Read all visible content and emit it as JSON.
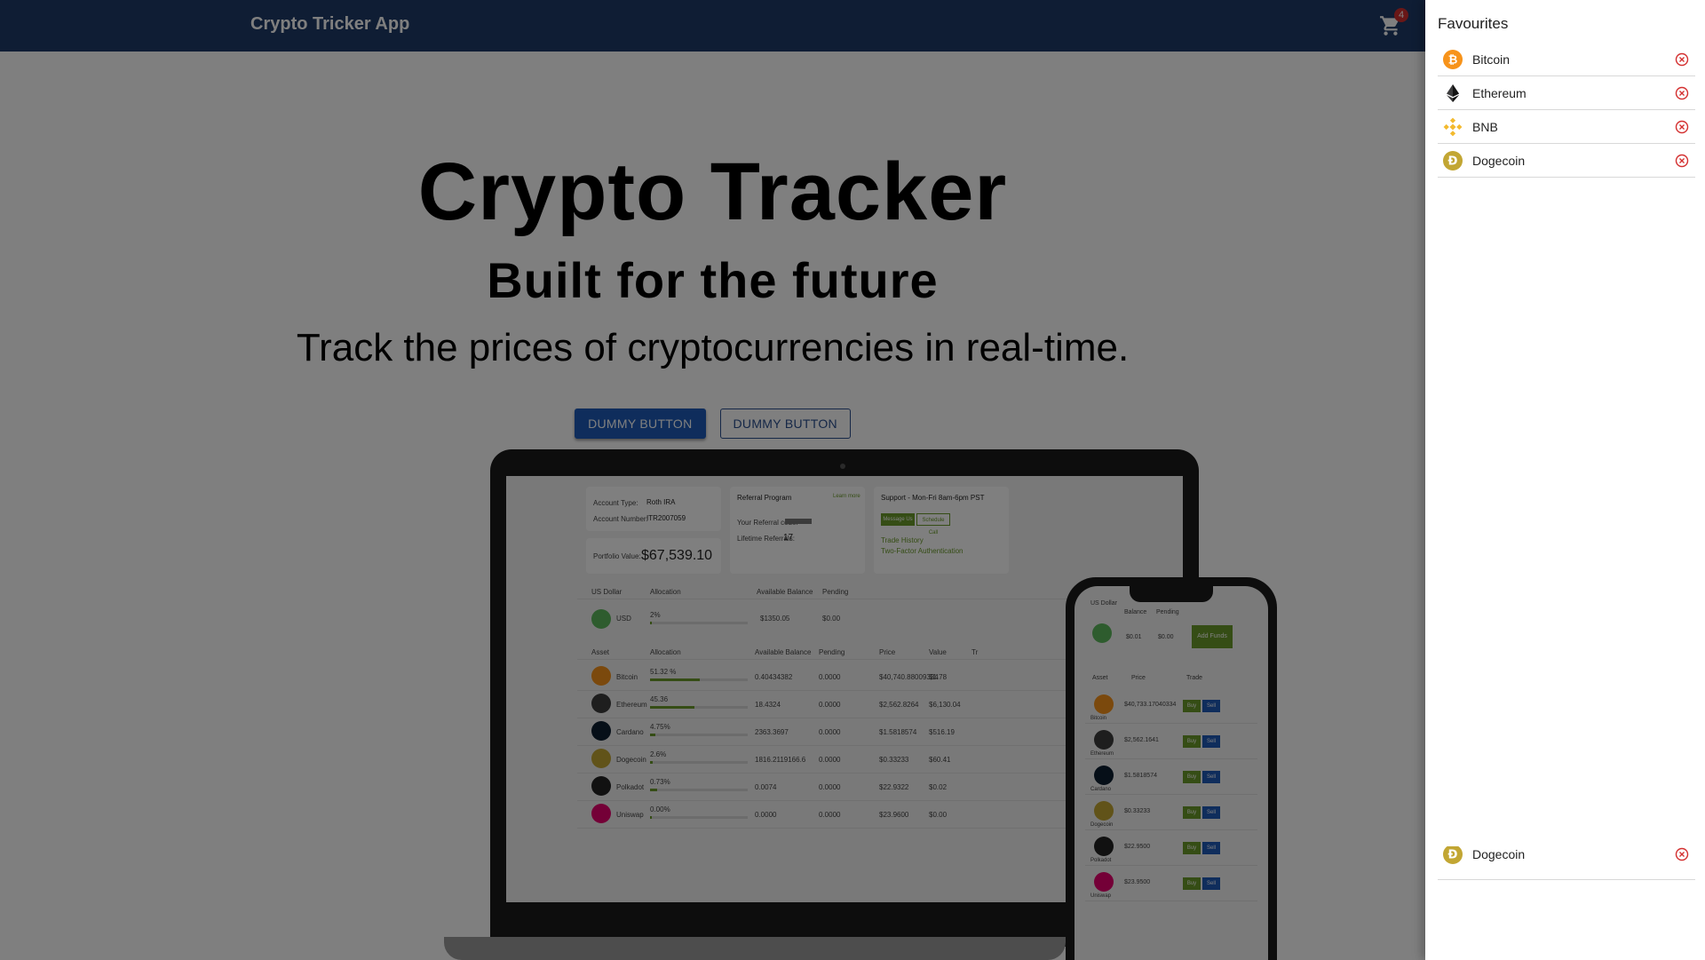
{
  "app": {
    "brand": "Crypto Tricker App",
    "cart_count": "4"
  },
  "hero": {
    "title": "Crypto Tracker",
    "subtitle": "Built for the future",
    "tagline": "Track the prices of cryptocurrencies in real-time.",
    "primary_button": "DUMMY BUTTON",
    "secondary_button": "DUMMY BUTTON"
  },
  "mockup": {
    "account_type_label": "Account Type:",
    "account_type": "Roth IRA",
    "account_number_label": "Account Number:",
    "account_number": "ITR2007059",
    "portfolio_label": "Portfolio Value:",
    "portfolio_value": "$67,539.10",
    "referral_title": "Referral Program",
    "referral_learn": "Learn more",
    "referral_code_label": "Your Referral code:",
    "referral_lifetime_label": "Lifetime Referrals:",
    "referral_lifetime": "17",
    "support_title": "Support - Mon-Fri 8am-6pm PST",
    "support_msg": "Message Us",
    "support_call": "Schedule Call",
    "support_trade_history": "Trade History",
    "support_2fa": "Two-Factor Authentication",
    "usd_header": [
      "US Dollar",
      "Allocation",
      "Available Balance",
      "Pending"
    ],
    "usd_row": {
      "name": "USD",
      "alloc": "2%",
      "balance": "$1350.05",
      "pending": "$0.00"
    },
    "asset_header": [
      "Asset",
      "Allocation",
      "Available Balance",
      "Pending",
      "Price",
      "Value",
      "Tr"
    ],
    "assets": [
      {
        "name": "Bitcoin",
        "alloc": "51.32 %",
        "balance": "0.40434382",
        "pending": "0.0000",
        "price": "$40,740.88009334",
        "value": "$1.78",
        "pct": 0.51,
        "color": "#f7931a"
      },
      {
        "name": "Ethereum",
        "alloc": "45.36",
        "balance": "18.4324",
        "pending": "0.0000",
        "price": "$2,562.8264",
        "value": "$6,130.04",
        "pct": 0.45,
        "color": "#3c3c3d"
      },
      {
        "name": "Cardano",
        "alloc": "4.75%",
        "balance": "2363.3697",
        "pending": "0.0000",
        "price": "$1.5818574",
        "value": "$516.19",
        "pct": 0.05,
        "color": "#0d1e30"
      },
      {
        "name": "Dogecoin",
        "alloc": "2.6%",
        "balance": "1816.2119166.6",
        "pending": "0.0000",
        "price": "$0.33233",
        "value": "$60.41",
        "pct": 0.03,
        "color": "#c2a633"
      },
      {
        "name": "Polkadot",
        "alloc": "0.73%",
        "balance": "0.0074",
        "pending": "0.0000",
        "price": "$22.9322",
        "value": "$0.02",
        "pct": 0.07,
        "color": "#222222"
      },
      {
        "name": "Uniswap",
        "alloc": "0.00%",
        "balance": "0.0000",
        "pending": "0.0000",
        "price": "$23.9600",
        "value": "$0.00",
        "pct": 0.0,
        "color": "#e8006f"
      }
    ],
    "phone": {
      "usd_header": [
        "US Dollar",
        "Balance",
        "Pending"
      ],
      "usd_balance": "$0.01",
      "usd_pending": "$0.00",
      "add_funds": "Add Funds",
      "asset_header": [
        "Asset",
        "Price",
        "Trade"
      ],
      "buy": "Buy",
      "sell": "Sell",
      "rows": [
        {
          "name": "Bitcoin",
          "price": "$40,733.17040334",
          "color": "#f7931a"
        },
        {
          "name": "Ethereum",
          "price": "$2,562.1641",
          "color": "#3c3c3d"
        },
        {
          "name": "Cardano",
          "price": "$1.5818574",
          "color": "#0d1e30"
        },
        {
          "name": "Dogecoin",
          "price": "$0.33233",
          "color": "#c2a633"
        },
        {
          "name": "Polkadot",
          "price": "$22.9500",
          "color": "#222222"
        },
        {
          "name": "Uniswap",
          "price": "$23.9500",
          "color": "#e8006f"
        }
      ]
    }
  },
  "drawer": {
    "title": "Favourites",
    "items": [
      {
        "name": "Bitcoin",
        "icon": "bitcoin-icon",
        "color": "#f7931a"
      },
      {
        "name": "Ethereum",
        "icon": "ethereum-icon",
        "color": "#3c3c3d"
      },
      {
        "name": "BNB",
        "icon": "bnb-icon",
        "color": "#f3ba2f"
      },
      {
        "name": "Dogecoin",
        "icon": "dogecoin-icon",
        "color": "#c2a633"
      }
    ],
    "ghost_item": {
      "name": "Dogecoin"
    }
  },
  "colors": {
    "topbar": "#1e3a68",
    "primary": "#1e5bb8",
    "remove": "#d32f2f"
  }
}
